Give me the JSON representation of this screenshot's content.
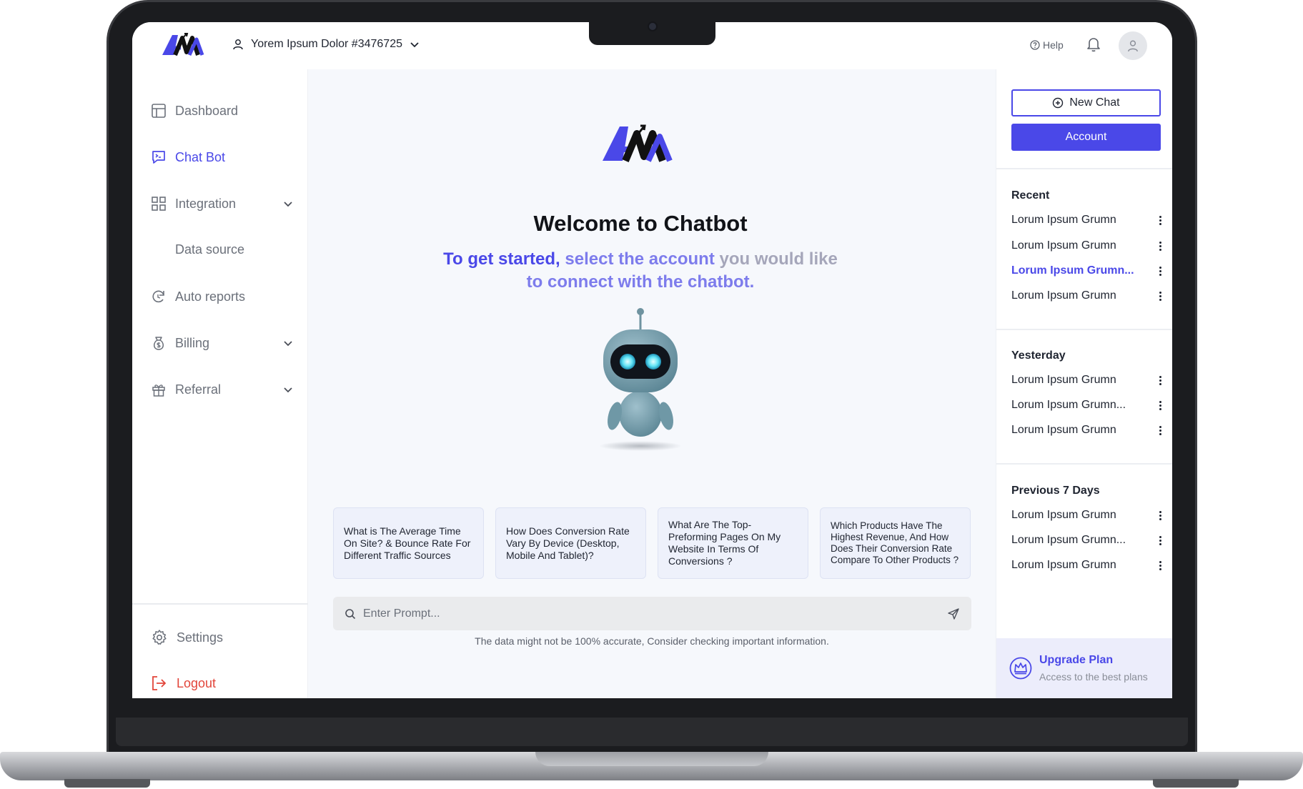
{
  "topbar": {
    "account_label": "Yorem Ipsum Dolor #3476725",
    "help_label": "Help"
  },
  "sidebar": {
    "items": [
      {
        "label": "Dashboard",
        "icon": "layout-icon"
      },
      {
        "label": "Chat Bot",
        "icon": "chat-icon"
      },
      {
        "label": "Integration",
        "icon": "grid-icon"
      },
      {
        "label": "Data source"
      },
      {
        "label": "Auto reports",
        "icon": "refresh-icon"
      },
      {
        "label": "Billing",
        "icon": "money-icon"
      },
      {
        "label": "Referral",
        "icon": "gift-icon"
      }
    ],
    "settings_label": "Settings",
    "logout_label": "Logout"
  },
  "main": {
    "welcome_title": "Welcome to Chatbot",
    "subtitle_part1": "To get started,",
    "subtitle_part2": "select the account",
    "subtitle_part3": "you would like",
    "subtitle_part4": "to connect with the chatbot.",
    "suggestions": [
      "What is The Average Time On Site? & Bounce Rate For Different Traffic Sources",
      "How Does Conversion Rate Vary By Device (Desktop, Mobile And Tablet)?",
      "What Are The Top-Preforming Pages On My Website In Terms Of Conversions ?",
      "Which Products Have The Highest Revenue, And How Does Their Conversion Rate Compare To Other Products ?"
    ],
    "prompt_placeholder": "Enter Prompt...",
    "disclaimer": "The data might not be 100% accurate, Consider checking important information."
  },
  "right_panel": {
    "new_chat_label": "New Chat",
    "account_label": "Account",
    "recent_title": "Recent",
    "recent_items": [
      "Lorum Ipsum Grumn",
      "Lorum Ipsum Grumn",
      "Lorum Ipsum Grumn...",
      "Lorum Ipsum Grumn"
    ],
    "yesterday_title": "Yesterday",
    "yesterday_items": [
      "Lorum Ipsum Grumn",
      "Lorum Ipsum Grumn...",
      "Lorum Ipsum Grumn"
    ],
    "previous_title": "Previous 7 Days",
    "previous_items": [
      "Lorum Ipsum Grumn",
      "Lorum Ipsum Grumn...",
      "Lorum Ipsum Grumn"
    ],
    "upgrade_title": "Upgrade Plan",
    "upgrade_subtitle": "Access to the best plans"
  },
  "colors": {
    "accent": "#4a48e8",
    "logout": "#e2453a",
    "background": "#f6f8fc"
  }
}
